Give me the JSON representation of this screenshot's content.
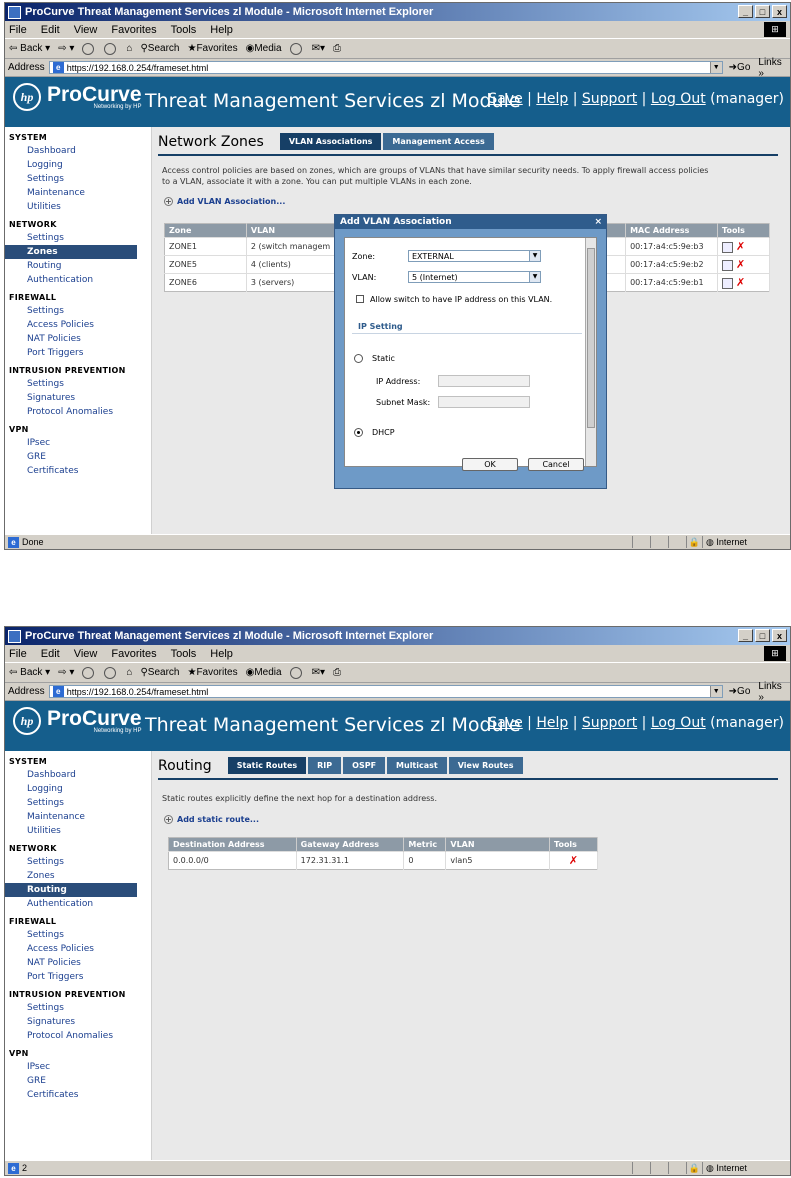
{
  "browser": {
    "title": "ProCurve Threat Management Services zl Module - Microsoft Internet Explorer",
    "menu": [
      "File",
      "Edit",
      "View",
      "Favorites",
      "Tools",
      "Help"
    ],
    "toolbar": {
      "back": "Back",
      "search": "Search",
      "favorites": "Favorites",
      "media": "Media"
    },
    "address_label": "Address",
    "url": "https://192.168.0.254/frameset.html",
    "go": "Go",
    "links": "Links",
    "window_buttons": {
      "min": "_",
      "max": "□",
      "close": "x"
    }
  },
  "banner": {
    "brand": "ProCurve",
    "brand_sub": "Networking by HP",
    "hp": "hp",
    "module_title": "Threat Management Services zl Module",
    "save": "Save",
    "help": "Help",
    "support": "Support",
    "logout": "Log Out",
    "user": "(manager)",
    "sep": "|"
  },
  "sidebar": {
    "system": {
      "heading": "SYSTEM",
      "items": [
        "Dashboard",
        "Logging",
        "Settings",
        "Maintenance",
        "Utilities"
      ]
    },
    "network": {
      "heading": "NETWORK",
      "items": [
        "Settings",
        "Zones",
        "Routing",
        "Authentication"
      ]
    },
    "firewall": {
      "heading": "FIREWALL",
      "items": [
        "Settings",
        "Access Policies",
        "NAT Policies",
        "Port Triggers"
      ]
    },
    "ips": {
      "heading": "INTRUSION PREVENTION",
      "items": [
        "Settings",
        "Signatures",
        "Protocol Anomalies"
      ]
    },
    "vpn": {
      "heading": "VPN",
      "items": [
        "IPsec",
        "GRE",
        "Certificates"
      ]
    }
  },
  "zones_page": {
    "heading": "Network Zones",
    "tabs": [
      "VLAN Associations",
      "Management Access"
    ],
    "description_1": "Access control policies are based on zones, which are groups of VLANs that have similar security needs. To apply firewall access policies",
    "description_2": "to a VLAN, associate it with a zone. You can put multiple VLANs in each zone.",
    "add_link": "Add VLAN Association...",
    "columns": [
      "Zone",
      "VLAN",
      "MAC Address",
      "Tools"
    ],
    "rows": [
      {
        "zone": "ZONE1",
        "vlan": "2 (switch managem",
        "mac": "00:17:a4:c5:9e:b3"
      },
      {
        "zone": "ZONE5",
        "vlan": "4 (clients)",
        "mac": "00:17:a4:c5:9e:b2"
      },
      {
        "zone": "ZONE6",
        "vlan": "3 (servers)",
        "mac": "00:17:a4:c5:9e:b1"
      }
    ],
    "status": "Done",
    "internet": "Internet"
  },
  "dialog": {
    "title": "Add VLAN Association",
    "close": "×",
    "zone_label": "Zone:",
    "zone_value": "EXTERNAL",
    "vlan_label": "VLAN:",
    "vlan_value": "5 (Internet)",
    "allow_ip": "Allow switch to have IP address on this VLAN.",
    "ip_setting": "IP Setting",
    "static": "Static",
    "ip_address": "IP Address:",
    "subnet_mask": "Subnet Mask:",
    "dhcp": "DHCP",
    "ok": "OK",
    "cancel": "Cancel"
  },
  "routing_page": {
    "heading": "Routing",
    "tabs": [
      "Static Routes",
      "RIP",
      "OSPF",
      "Multicast",
      "View Routes"
    ],
    "description": "Static routes explicitly define the next hop for a destination address.",
    "add_link": "Add static route...",
    "columns": [
      "Destination Address",
      "Gateway Address",
      "Metric",
      "VLAN",
      "Tools"
    ],
    "rows": [
      {
        "destination": "0.0.0.0/0",
        "gateway": "172.31.31.1",
        "metric": "0",
        "vlan": "vlan5"
      }
    ],
    "status": "2",
    "internet": "Internet"
  },
  "icons": [
    "hp-logo-icon",
    "back-icon",
    "forward-icon",
    "stop-icon",
    "refresh-icon",
    "home-icon",
    "search-icon",
    "favorites-icon",
    "media-icon",
    "history-icon",
    "mail-icon",
    "print-icon",
    "ie-page-icon",
    "go-icon",
    "edit-icon",
    "delete-icon",
    "add-icon",
    "lock-icon",
    "globe-icon"
  ],
  "colors": {
    "banner": "#155e8c",
    "tab": "#3c6a93",
    "tab_active": "#163f66",
    "delete": "#dd0000",
    "selected": "#2a4d7a"
  }
}
